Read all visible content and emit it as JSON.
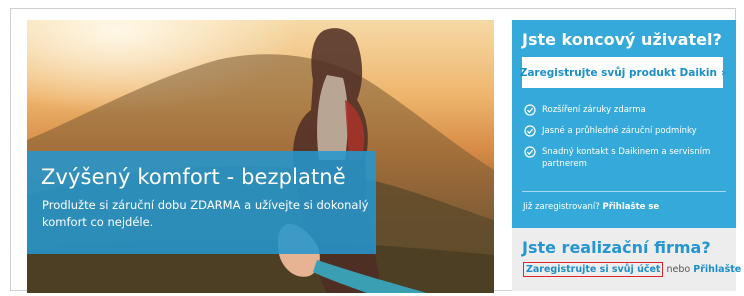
{
  "hero": {
    "title": "Zvýšený komfort - bezplatně",
    "text": "Prodlužte si záruční dobu ZDARMA a užívejte si dokonalý komfort co nejdéle."
  },
  "end_user": {
    "heading": "Jste koncový uživatel?",
    "register_button": "Zaregistrujte svůj produkt Daikin",
    "register_arrow": "›",
    "benefits": [
      "Rozšíření záruky zdarma",
      "Jasné a průhledné záruční podmínky",
      "Snadný kontakt s Daikinem a servisním partnerem"
    ],
    "already_registered": "Již zaregistrovaní?",
    "login": "Přihlašte se"
  },
  "company": {
    "heading": "Jste realizační firma?",
    "register_link": "Zaregistrujte si svůj účet",
    "or": "nebo",
    "login": "Přihlašte se"
  },
  "colors": {
    "panel_blue": "#35a9d9",
    "hero_box_blue": "#2696cd",
    "link_blue": "#1b8fca",
    "highlight_red": "#e0262d"
  },
  "icons": [
    "check-circle-icon",
    "chevron-right-icon"
  ]
}
